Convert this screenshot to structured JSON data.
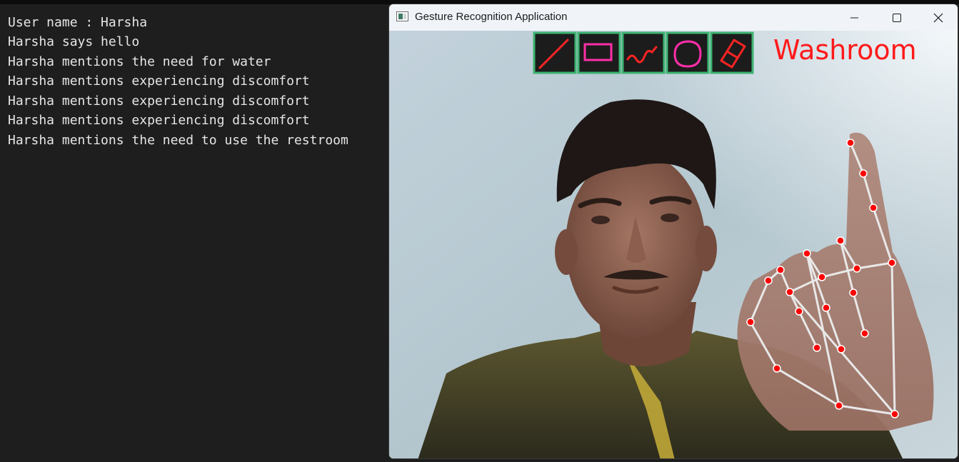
{
  "console": {
    "lines": [
      "User name : Harsha",
      "Harsha says hello",
      "Harsha mentions the need for water",
      "Harsha mentions experiencing discomfort",
      "Harsha mentions experiencing discomfort",
      "Harsha mentions experiencing discomfort",
      "Harsha mentions the need to use the restroom"
    ]
  },
  "window": {
    "title": "Gesture Recognition Application",
    "controls": [
      "minimize-icon",
      "maximize-icon",
      "close-icon"
    ]
  },
  "overlay": {
    "gesture_label": "Washroom",
    "label_color": "#ff1a1a",
    "tools": [
      "line-tool-icon",
      "rectangle-tool-icon",
      "freehand-tool-icon",
      "circle-tool-icon",
      "eraser-tool-icon"
    ],
    "tool_border_color": "#3cb371",
    "tool_bg_color": "#1c1c1c",
    "landmark_color": "#ff0000",
    "connection_color": "#e6e6e6"
  }
}
